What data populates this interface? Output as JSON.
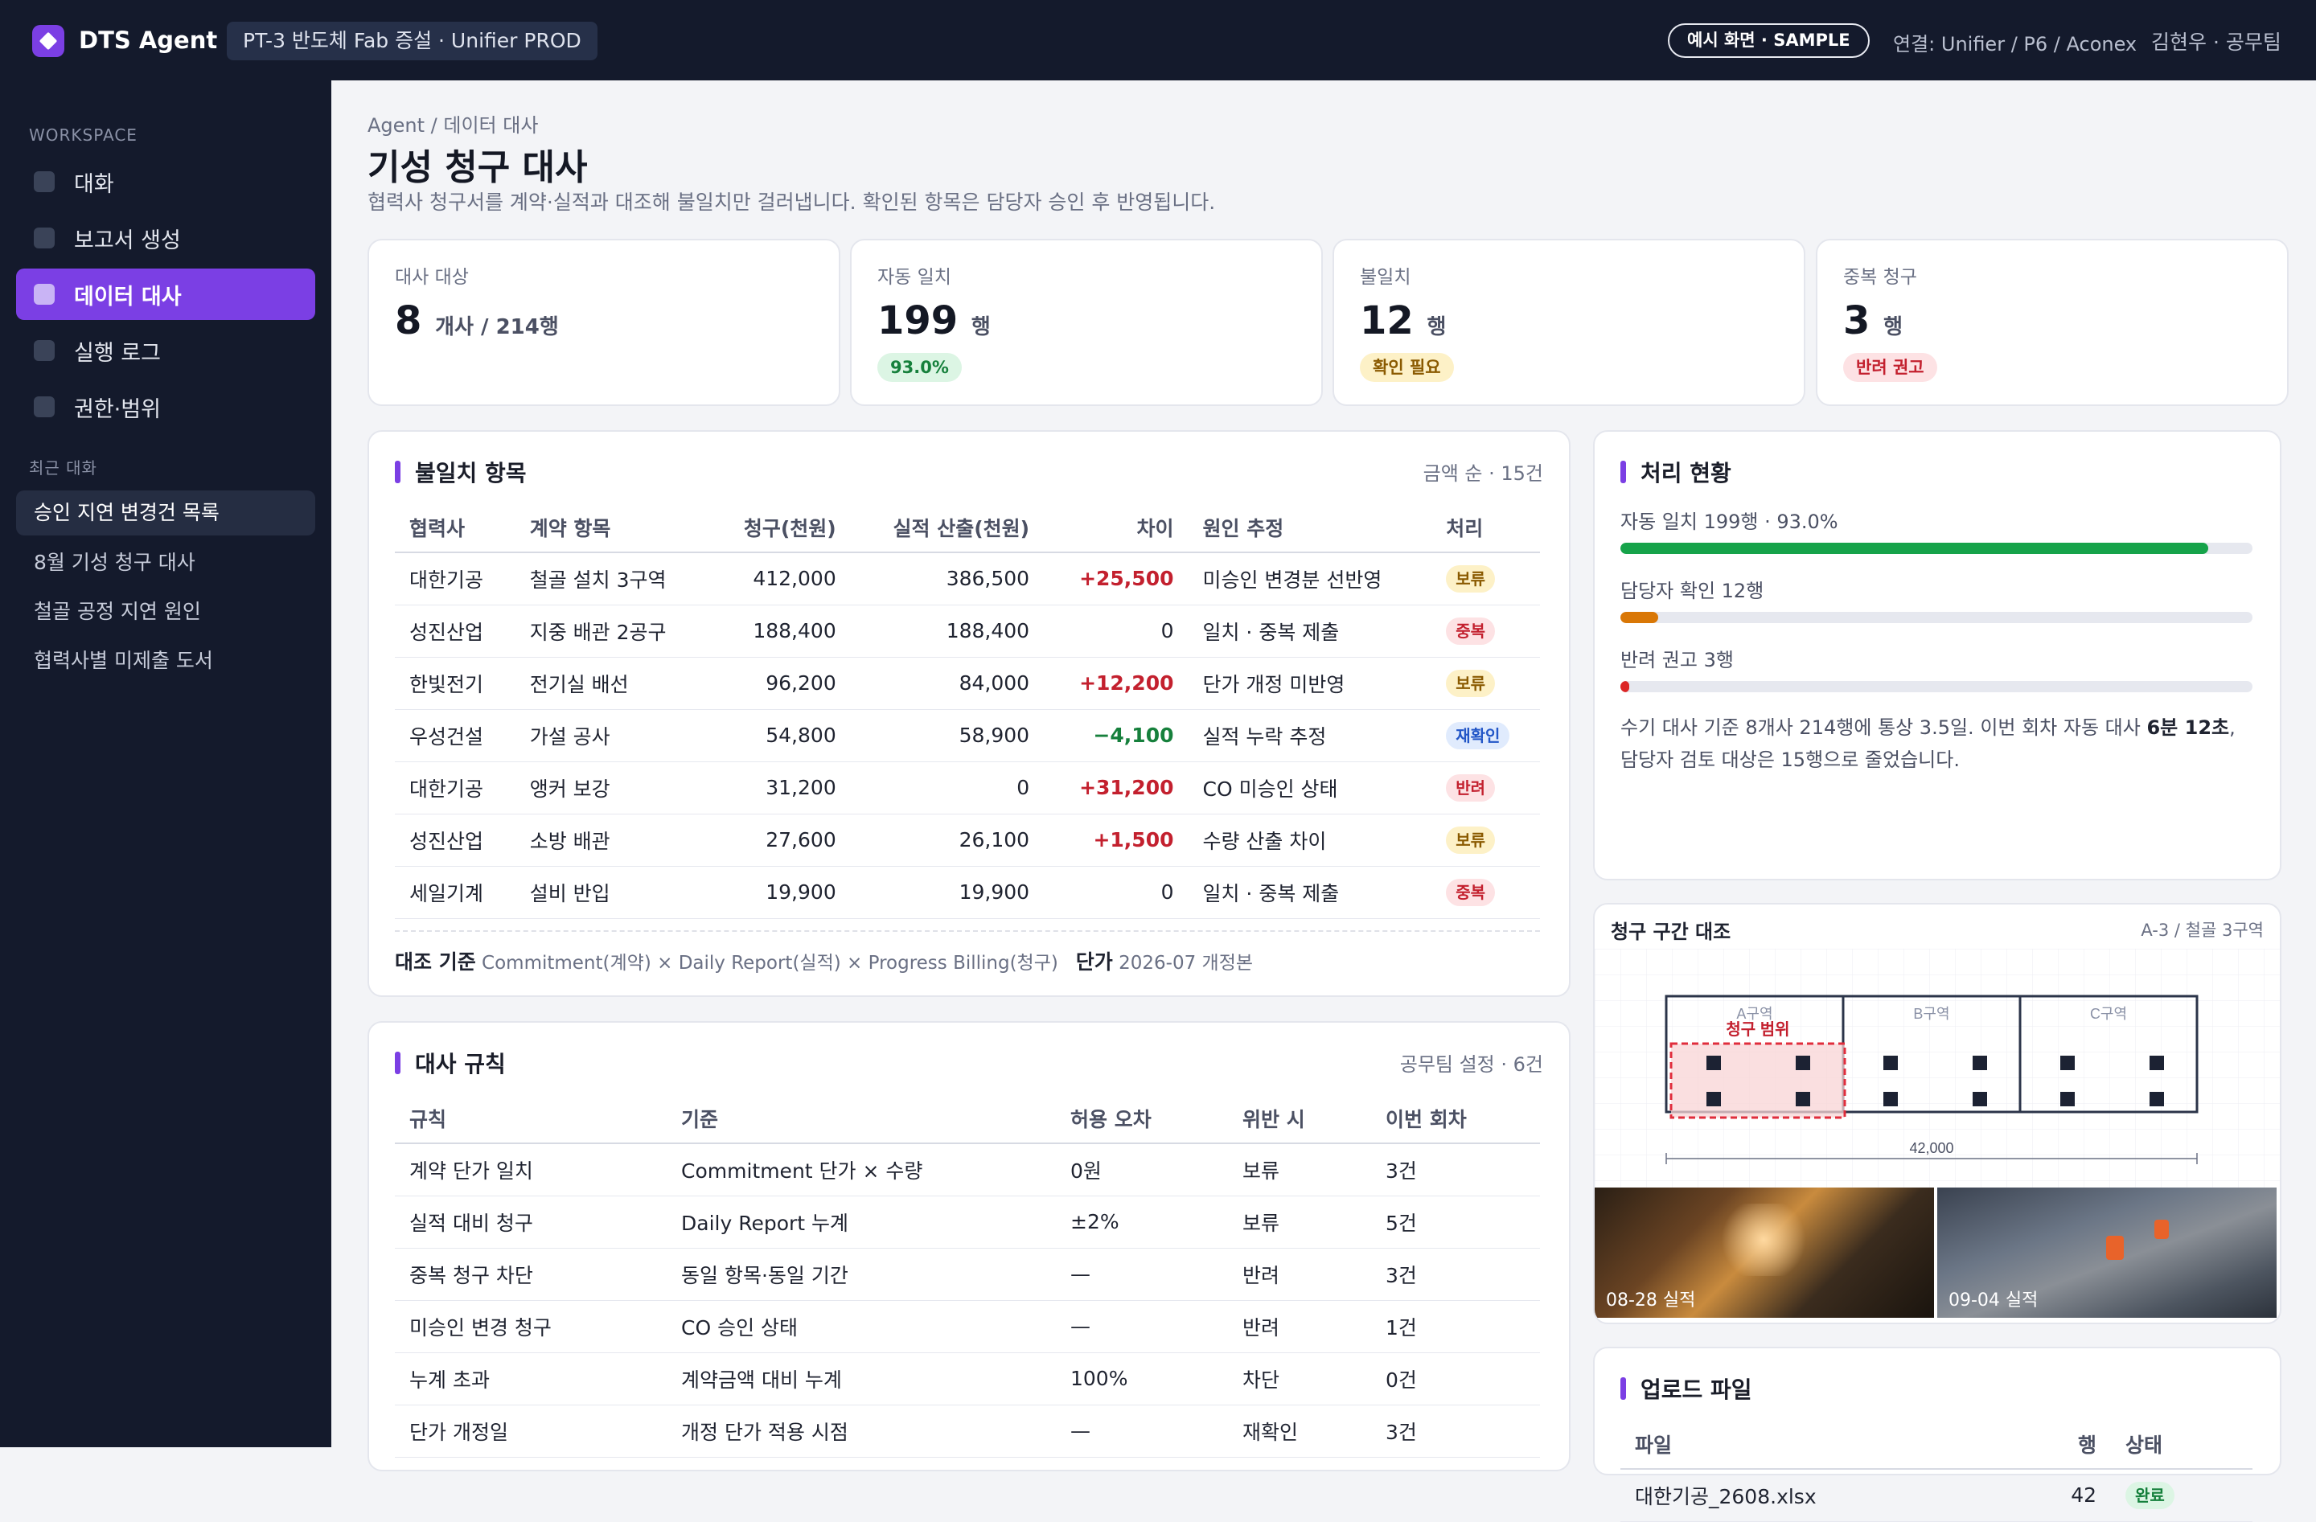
{
  "header": {
    "brand": "DTS Agent",
    "project": "PT-3 반도체 Fab 증설 · Unifier PROD",
    "sample_badge": "예시 화면 · SAMPLE",
    "connection": "연결: Unifier / P6 / Aconex",
    "user": "김현우 · 공무팀"
  },
  "sidebar": {
    "workspace_label": "WORKSPACE",
    "items": [
      {
        "label": "대화"
      },
      {
        "label": "보고서 생성"
      },
      {
        "label": "데이터 대사"
      },
      {
        "label": "실행 로그"
      },
      {
        "label": "권한·범위"
      }
    ],
    "recent_label": "최근 대화",
    "recent": [
      {
        "label": "승인 지연 변경건 목록"
      },
      {
        "label": "8월 기성 청구 대사"
      },
      {
        "label": "철골 공정 지연 원인"
      },
      {
        "label": "협력사별 미제출 도서"
      }
    ]
  },
  "page": {
    "breadcrumb": "Agent / 데이터 대사",
    "title": "기성 청구 대사",
    "subtitle": "협력사 청구서를 계약·실적과 대조해 불일치만 걸러냅니다. 확인된 항목은 담당자 승인 후 반영됩니다."
  },
  "kpis": [
    {
      "label": "대사 대상",
      "value": "8",
      "unit": "개사 / 214행",
      "badge": ""
    },
    {
      "label": "자동 일치",
      "value": "199",
      "unit": "행",
      "badge": "93.0%"
    },
    {
      "label": "불일치",
      "value": "12",
      "unit": "행",
      "badge": "확인 필요"
    },
    {
      "label": "중복 청구",
      "value": "3",
      "unit": "행",
      "badge": "반려 권고"
    }
  ],
  "mismatch": {
    "title": "불일치 항목",
    "meta": "금액 순 · 15건",
    "columns": [
      "협력사",
      "계약 항목",
      "청구(천원)",
      "실적 산출(천원)",
      "차이",
      "원인 추정",
      "처리"
    ],
    "rows": [
      {
        "vendor": "대한기공",
        "item": "철골 설치 3구역",
        "claim": "412,000",
        "actual": "386,500",
        "diff": "+25,500",
        "cause": "미승인 변경분 선반영",
        "action": "보류"
      },
      {
        "vendor": "성진산업",
        "item": "지중 배관 2공구",
        "claim": "188,400",
        "actual": "188,400",
        "diff": "0",
        "cause": "일치 · 중복 제출",
        "action": "중복"
      },
      {
        "vendor": "한빛전기",
        "item": "전기실 배선",
        "claim": "96,200",
        "actual": "84,000",
        "diff": "+12,200",
        "cause": "단가 개정 미반영",
        "action": "보류"
      },
      {
        "vendor": "우성건설",
        "item": "가설 공사",
        "claim": "54,800",
        "actual": "58,900",
        "diff": "−4,100",
        "cause": "실적 누락 추정",
        "action": "재확인"
      },
      {
        "vendor": "대한기공",
        "item": "앵커 보강",
        "claim": "31,200",
        "actual": "0",
        "diff": "+31,200",
        "cause": "CO 미승인 상태",
        "action": "반려"
      },
      {
        "vendor": "성진산업",
        "item": "소방 배관",
        "claim": "27,600",
        "actual": "26,100",
        "diff": "+1,500",
        "cause": "수량 산출 차이",
        "action": "보류"
      },
      {
        "vendor": "세일기계",
        "item": "설비 반입",
        "claim": "19,900",
        "actual": "19,900",
        "diff": "0",
        "cause": "일치 · 중복 제출",
        "action": "중복"
      }
    ],
    "footer_basis_label": "대조 기준",
    "footer_basis": "Commitment(계약) × Daily Report(실적) × Progress Billing(청구)",
    "footer_price_label": "단가",
    "footer_price": "2026-07 개정본"
  },
  "rules": {
    "title": "대사 규칙",
    "meta": "공무팀 설정 · 6건",
    "columns": [
      "규칙",
      "기준",
      "허용 오차",
      "위반 시",
      "이번 회차"
    ],
    "rows": [
      {
        "rule": "계약 단가 일치",
        "basis": "Commitment 단가 × 수량",
        "tolerance": "0원",
        "violation": "보류",
        "count": "3건"
      },
      {
        "rule": "실적 대비 청구",
        "basis": "Daily Report 누계",
        "tolerance": "±2%",
        "violation": "보류",
        "count": "5건"
      },
      {
        "rule": "중복 청구 차단",
        "basis": "동일 항목·동일 기간",
        "tolerance": "—",
        "violation": "반려",
        "count": "3건"
      },
      {
        "rule": "미승인 변경 청구",
        "basis": "CO 승인 상태",
        "tolerance": "—",
        "violation": "반려",
        "count": "1건"
      },
      {
        "rule": "누계 초과",
        "basis": "계약금액 대비 누계",
        "tolerance": "100%",
        "violation": "차단",
        "count": "0건"
      },
      {
        "rule": "단가 개정일",
        "basis": "개정 단가 적용 시점",
        "tolerance": "—",
        "violation": "재확인",
        "count": "3건"
      }
    ]
  },
  "status": {
    "title": "처리 현황",
    "bars": [
      {
        "label": "자동 일치 199행 · 93.0%",
        "fraction": 0.93,
        "color": "#16a34a"
      },
      {
        "label": "담당자 확인 12행",
        "fraction": 0.06,
        "color": "#d97706"
      },
      {
        "label": "반려 권고 3행",
        "fraction": 0.014,
        "color": "#dc2626"
      }
    ],
    "note_prefix": "수기 대사 기준 8개사 214행에 통상 3.5일. 이번 회차 자동 대사 ",
    "note_bold": "6분 12초",
    "note_suffix": ", 담당자 검토 대상은 15행으로 줄었습니다."
  },
  "drawing": {
    "title": "청구 구간 대조",
    "location": "A-3 / 철골 3구역",
    "zone_a": "A구역",
    "zone_b": "B구역",
    "zone_c": "C구역",
    "claim_range": "청구 범위",
    "dimension": "42,000",
    "photo_1": "08-28 실적",
    "photo_2": "09-04 실적"
  },
  "uploads": {
    "title": "업로드 파일",
    "columns": [
      "파일",
      "행",
      "상태"
    ],
    "rows": [
      {
        "file": "대한기공_2608.xlsx",
        "rows": "42",
        "status": "완료"
      }
    ]
  },
  "colors": {
    "accent": "#7b3fe4",
    "topbar": "#141a2c",
    "sidebar": "#141a2c"
  }
}
